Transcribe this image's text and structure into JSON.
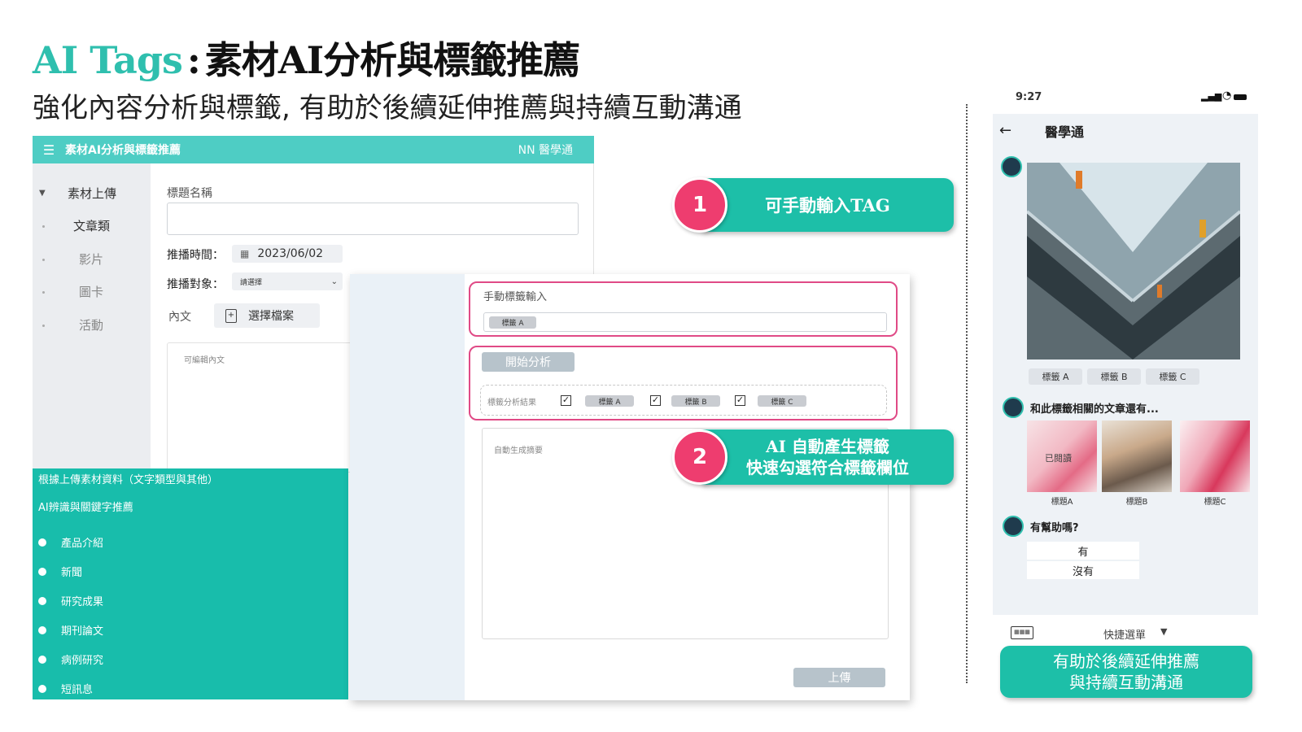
{
  "slide": {
    "title_accent": "AI Tags",
    "title_separator": ":",
    "title_main": "素材AI分析與標籤推薦",
    "subtitle": "強化內容分析與標籤, 有助於後續延伸推薦與持續互動溝通"
  },
  "app": {
    "header_title": "素材AI分析與標籤推薦",
    "header_brand": "NN 醫學通",
    "sidebar": {
      "group": "素材上傳",
      "items": [
        "文章類",
        "影片",
        "圖卡",
        "活動"
      ]
    },
    "form": {
      "title_label": "標題名稱",
      "time_label": "推播時間：",
      "time_value": "2023/06/02",
      "target_label": "推播對象：",
      "target_placeholder": "請選擇",
      "body_label": "內文",
      "file_button": "選擇檔案",
      "editable_placeholder": "可編輯內文"
    }
  },
  "ai_panel": {
    "line1": "根據上傳素材資料（文字類型與其他）",
    "line2": "AI辨識與關鍵字推薦",
    "items": [
      "產品介紹",
      "新聞",
      "研究成果",
      "期刊論文",
      "病例研究",
      "短訊息"
    ]
  },
  "tag_panel": {
    "manual_label": "手動標籤輸入",
    "manual_tag": "標籤 A",
    "analyze_button": "開始分析",
    "result_label": "標籤分析結果",
    "result_tags": [
      "標籤 A",
      "標籤 B",
      "標籤 C"
    ],
    "summary_placeholder": "自動生成摘要",
    "upload_button": "上傳"
  },
  "callouts": {
    "c1_number": "1",
    "c1_text": "可手動輸入TAG",
    "c2_number": "2",
    "c2_line1": "AI 自動產生標籤",
    "c2_line2": "快速勾選符合標籤欄位",
    "c3_line1": "有助於後續延伸推薦",
    "c3_line2": "與持續互動溝通"
  },
  "phone": {
    "time": "9:27",
    "app_title": "醫學通",
    "tags": [
      "標籤 A",
      "標籤 B",
      "標籤 C"
    ],
    "related_text": "和此標籤相關的文章還有...",
    "read_badge": "已閱讀",
    "thumb_captions": [
      "標題A",
      "標題B",
      "標題C"
    ],
    "helpful_question": "有幫助嗎?",
    "options": [
      "有",
      "沒有"
    ],
    "quick_menu": "快捷選單"
  },
  "colors": {
    "teal": "#4ecdc4",
    "teal_dark": "#18bdab",
    "pink": "#e04a86",
    "badge_pink": "#ee3d6f"
  }
}
